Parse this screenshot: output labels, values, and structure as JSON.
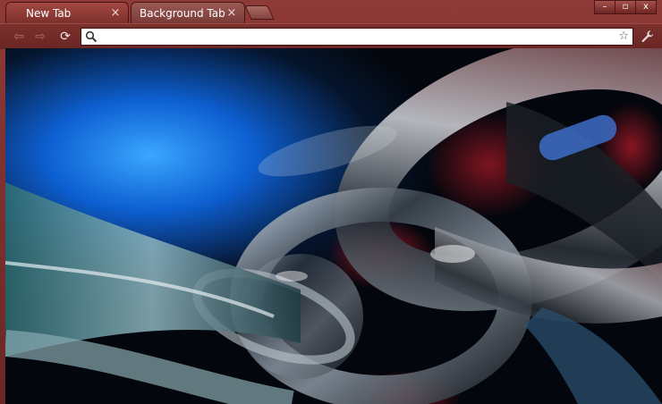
{
  "tabs": [
    {
      "label": "New Tab",
      "close": "×"
    },
    {
      "label": "Background Tab",
      "close": "×"
    }
  ],
  "window_controls": {
    "minimize": "–",
    "maximize": "▫",
    "close": "x"
  },
  "toolbar": {
    "back": "⇦",
    "forward": "⇨",
    "reload": "⟳"
  },
  "omnibox": {
    "value": "",
    "star": "☆"
  },
  "colors": {
    "frame": "#7a2a2a",
    "accent": "#a24843"
  }
}
